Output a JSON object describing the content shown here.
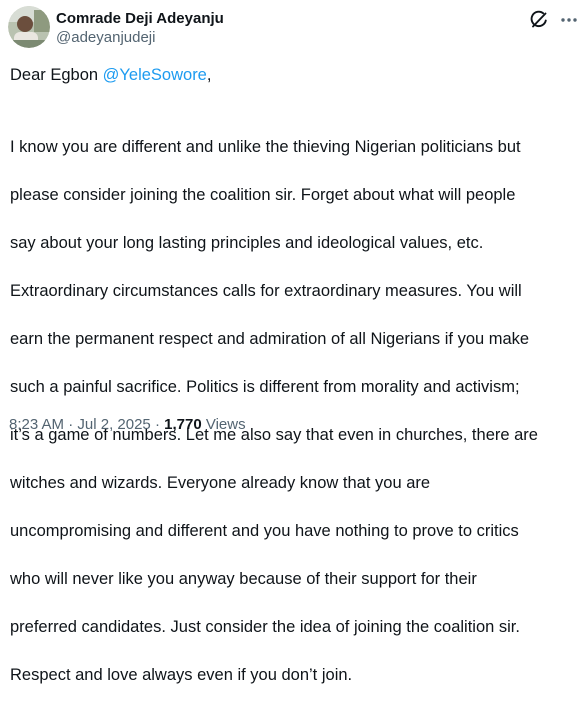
{
  "author": {
    "display_name": "Comrade Deji Adeyanju",
    "handle": "@adeyanjudeji"
  },
  "icons": {
    "avatar": "profile-photo",
    "grok": "grok-icon",
    "more": "more-options-icon"
  },
  "tweet": {
    "greeting_prefix": "Dear Egbon ",
    "mention": "@YeleSowore",
    "greeting_suffix": ",",
    "lines": [
      "I know you are different and unlike the thieving Nigerian politicians but",
      "please consider joining the coalition sir. Forget about what will people",
      "say about your long lasting principles and ideological values, etc.",
      "Extraordinary circumstances calls for extraordinary measures. You will",
      "earn the permanent respect and admiration of all Nigerians if you make",
      "such a painful sacrifice. Politics is different from morality and activism;",
      "it’s a game of numbers. Let me also say that even in churches, there are",
      "witches and wizards. Everyone already know that you are",
      "uncompromising and different and you have nothing to prove to critics",
      "who will never like you anyway because of their support for their",
      "preferred candidates. Just consider the idea of joining the coalition sir.",
      "Respect and love always even if you don’t join."
    ]
  },
  "meta": {
    "time": "8:23 AM",
    "separator": " · ",
    "date": "Jul 2, 2025",
    "views_count": "1,770",
    "views_label": " Views"
  },
  "colors": {
    "link": "#1d9bf0",
    "text": "#0f1419",
    "muted": "#536471"
  }
}
